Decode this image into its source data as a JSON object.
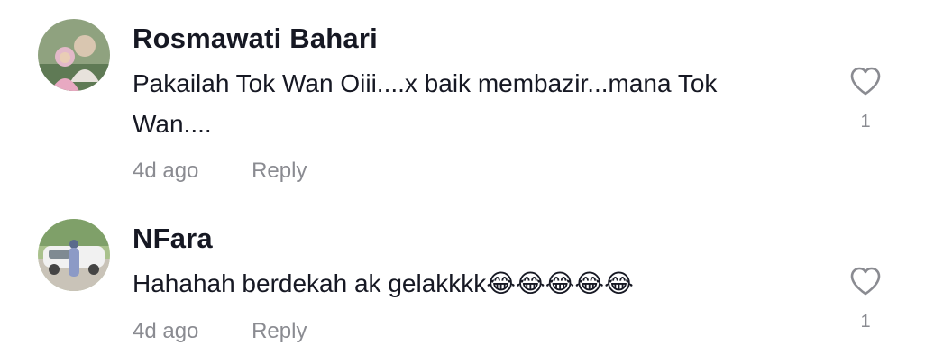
{
  "comments": [
    {
      "username": "Rosmawati Bahari",
      "text": "Pakailah Tok Wan Oiii....x baik membazir...mana Tok Wan....",
      "time": "4d ago",
      "reply_label": "Reply",
      "like_count": "1"
    },
    {
      "username": "NFara",
      "text": "Hahahah berdekah ak gelakkkk😂😂😂😂😂",
      "time": "4d ago",
      "reply_label": "Reply",
      "like_count": "1"
    }
  ],
  "icons": {
    "like": "heart-outline-icon"
  },
  "colors": {
    "text": "#161823",
    "secondary": "#8a8b91",
    "background": "#ffffff"
  }
}
